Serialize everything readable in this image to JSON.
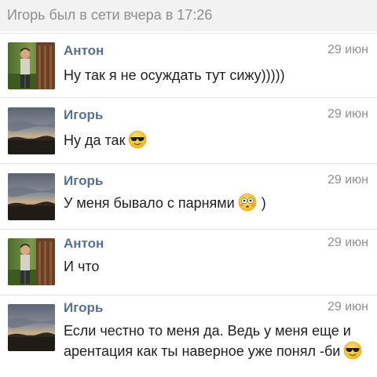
{
  "status": "Игорь был в сети вчера в 17:26",
  "messages": [
    {
      "author": "Антон",
      "date": "29 июн",
      "avatar": "anton-photo",
      "lines": [
        "Ну так я не осуждать тут сижу)))))"
      ]
    },
    {
      "author": "Игорь",
      "date": "29 июн",
      "avatar": "sunset-photo",
      "lines": [
        "Ну да так"
      ],
      "emoji": "sunglasses-emoji"
    },
    {
      "author": "Игорь",
      "date": "29 июн",
      "avatar": "sunset-photo",
      "lines": [
        "У меня бывало с парнями"
      ],
      "emoji": "flushed-emoji",
      "after_emoji": ")"
    },
    {
      "author": "Антон",
      "date": "29 июн",
      "avatar": "anton-photo",
      "lines": [
        "И что"
      ]
    },
    {
      "author": "Игорь",
      "date": "29 июн",
      "avatar": "sunset-photo",
      "lines": [
        "Если честно то меня да. Ведь у меня еще и",
        "арентация как ты наверное уже понял -би"
      ],
      "emoji": "sunglasses-emoji"
    }
  ],
  "colors": {
    "author": "#56718f",
    "meta": "#8e8e8e",
    "separator": "#e3e3e3",
    "status_bg": "#f2f2f2"
  }
}
